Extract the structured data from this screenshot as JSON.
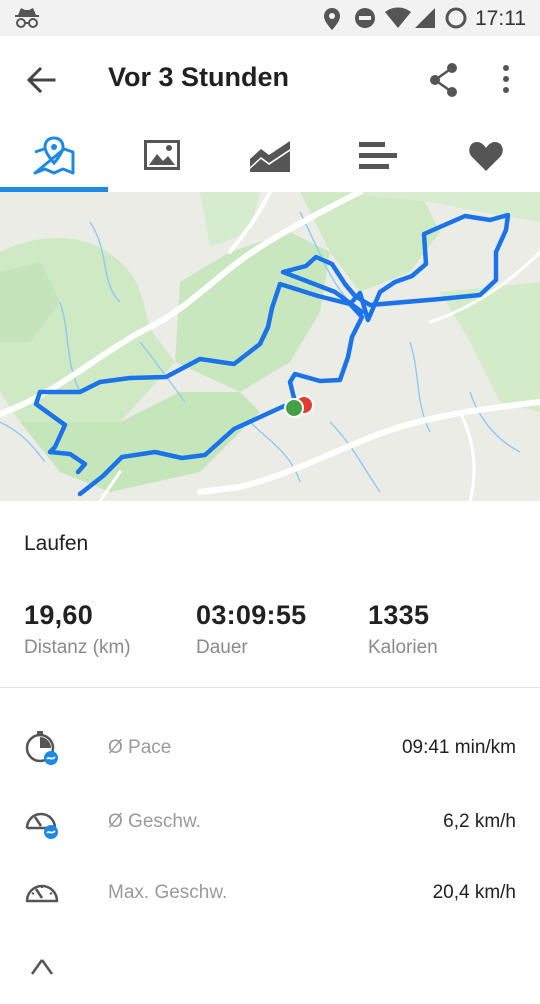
{
  "status_bar": {
    "time": "17:11"
  },
  "header": {
    "title": "Vor 3 Stunden"
  },
  "tabs": [
    {
      "icon": "map-pin-icon",
      "active": true
    },
    {
      "icon": "image-icon",
      "active": false
    },
    {
      "icon": "chart-icon",
      "active": false
    },
    {
      "icon": "bars-icon",
      "active": false
    },
    {
      "icon": "heart-icon",
      "active": false
    }
  ],
  "colors": {
    "accent": "#1e88e5",
    "route": "#1a73e8",
    "start": "#43a047",
    "end": "#e53935"
  },
  "activity": {
    "sport": "Laufen",
    "stats": [
      {
        "value": "19,60",
        "label": "Distanz (km)"
      },
      {
        "value": "03:09:55",
        "label": "Dauer"
      },
      {
        "value": "1335",
        "label": "Kalorien"
      }
    ]
  },
  "details": [
    {
      "icon": "pace-icon",
      "label": "Ø Pace",
      "value": "09:41 min/km"
    },
    {
      "icon": "speed-icon",
      "label": "Ø Geschw.",
      "value": "6,2 km/h"
    },
    {
      "icon": "speedometer-icon",
      "label": "Max. Geschw.",
      "value": "20,4 km/h"
    }
  ]
}
